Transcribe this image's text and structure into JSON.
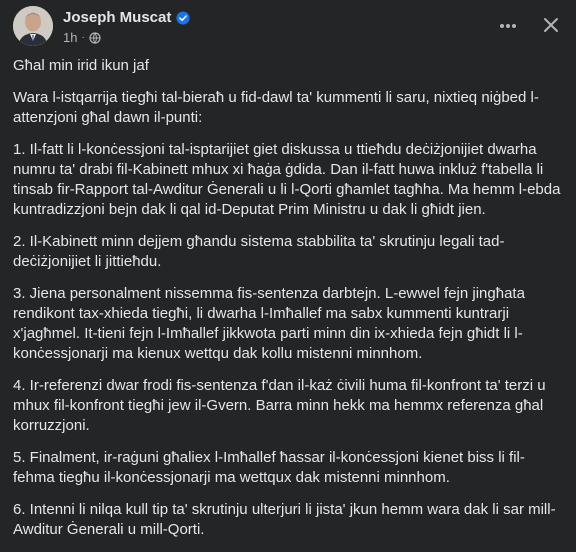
{
  "post": {
    "author": "Joseph Muscat",
    "timestamp": "1h",
    "verified_icon": "verified-badge-icon",
    "privacy_icon": "globe-icon",
    "more_icon": "more-horizontal-icon",
    "close_icon": "close-icon",
    "paragraphs": [
      "Għal min irid ikun jaf",
      "Wara l-istqarrija tiegħi tal-bieraħ u fid-dawl ta' kummenti li saru, nixtieq niġbed l-attenzjoni għal dawn il-punti:",
      "1. Il-fatt li l-konċessjoni tal-isptarijiet giet diskussa u ttieħdu deċiżjonijiet dwarha numru ta' drabi fil-Kabinett mhux xi ħaġa ġdida.  Dan il-fatt huwa inkluż f'tabella li tinsab fir-Rapport tal-Awditur Ġenerali u li l-Qorti għamlet tagħha.  Ma hemm l-ebda kuntradizzjoni bejn dak li qal id-Deputat Prim Ministru u dak li għidt jien.",
      "2. Il-Kabinett minn dejjem għandu sistema stabbilita ta' skrutinju legali tad-deċiżjonijiet li jittieħdu.",
      "3. Jiena personalment nissemma fis-sentenza darbtejn.  L-ewwel fejn jingħata rendikont tax-xhieda tiegħi, li dwarha l-Imħallef ma sabx kummenti kuntrarji x'jagħmel.  It-tieni fejn l-Imħallef jikkwota parti minn din ix-xhieda fejn għidt li l-konċessjonarji ma kienux wettqu dak kollu mistenni minnhom.",
      "4. Ir-referenzi dwar frodi fis-sentenza f'dan il-każ ċivili huma fil-konfront ta' terzi u mhux fil-konfront tiegħi jew il-Gvern.  Barra minn hekk ma hemmx referenza għal korruzzjoni.",
      "5. Finalment, ir-raġuni għaliex l-Imħallef ħassar il-konċessjoni kienet biss li fil-fehma tiegħu il-konċessjonarji ma wettqux dak mistenni minnhom.",
      "6. Intenni li nilqa kull tip ta' skrutinju ulterjuri li jista' jkun hemm wara dak li sar mill-Awditur Ġenerali u mill-Qorti."
    ]
  }
}
